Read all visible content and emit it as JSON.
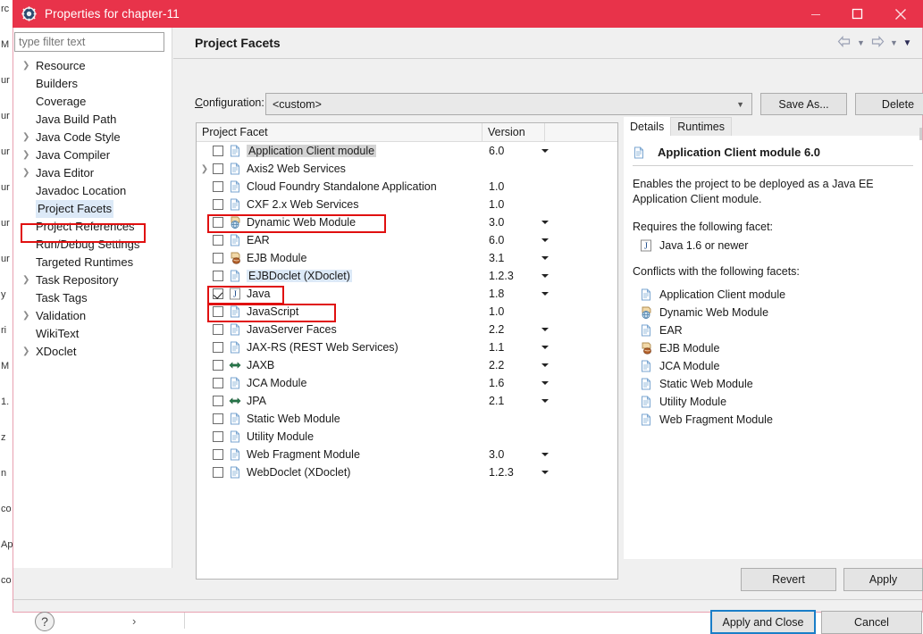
{
  "window": {
    "title": "Properties for chapter-11",
    "icon": "gear-icon",
    "accent_color": "#e8334a",
    "controls": {
      "minimize": "—",
      "maximize": "☐",
      "close": "✕"
    }
  },
  "sidebar": {
    "filter_placeholder": "type filter text",
    "filter_value": "",
    "items": [
      {
        "label": "Resource",
        "expandable": true,
        "selected": false
      },
      {
        "label": "Builders",
        "expandable": false,
        "selected": false
      },
      {
        "label": "Coverage",
        "expandable": false,
        "selected": false
      },
      {
        "label": "Java Build Path",
        "expandable": false,
        "selected": false
      },
      {
        "label": "Java Code Style",
        "expandable": true,
        "selected": false
      },
      {
        "label": "Java Compiler",
        "expandable": true,
        "selected": false
      },
      {
        "label": "Java Editor",
        "expandable": true,
        "selected": false
      },
      {
        "label": "Javadoc Location",
        "expandable": false,
        "selected": false
      },
      {
        "label": "Project Facets",
        "expandable": false,
        "selected": true
      },
      {
        "label": "Project References",
        "expandable": false,
        "selected": false
      },
      {
        "label": "Run/Debug Settings",
        "expandable": false,
        "selected": false
      },
      {
        "label": "Targeted Runtimes",
        "expandable": false,
        "selected": false
      },
      {
        "label": "Task Repository",
        "expandable": true,
        "selected": false
      },
      {
        "label": "Task Tags",
        "expandable": false,
        "selected": false
      },
      {
        "label": "Validation",
        "expandable": true,
        "selected": false
      },
      {
        "label": "WikiText",
        "expandable": false,
        "selected": false
      },
      {
        "label": "XDoclet",
        "expandable": true,
        "selected": false
      }
    ]
  },
  "page": {
    "title": "Project Facets",
    "nav": {
      "back_icon": "back-arrow-icon",
      "forward_icon": "forward-arrow-icon",
      "menu_icon": "chevron-down-icon"
    }
  },
  "configuration": {
    "label": "Configuration:",
    "value": "<custom>",
    "save_as_label": "Save As...",
    "delete_label": "Delete"
  },
  "facet_table": {
    "columns": [
      "Project Facet",
      "Version",
      ""
    ],
    "rows": [
      {
        "name": "Application Client module",
        "version": "6.0",
        "checked": false,
        "expandable": false,
        "has_version_dropdown": true,
        "icon": "file-icon",
        "state": "selected"
      },
      {
        "name": "Axis2 Web Services",
        "version": "",
        "checked": false,
        "expandable": true,
        "has_version_dropdown": false,
        "icon": "file-icon",
        "state": ""
      },
      {
        "name": "Cloud Foundry Standalone Application",
        "version": "1.0",
        "checked": false,
        "expandable": false,
        "has_version_dropdown": false,
        "icon": "file-icon",
        "state": ""
      },
      {
        "name": "CXF 2.x Web Services",
        "version": "1.0",
        "checked": false,
        "expandable": false,
        "has_version_dropdown": false,
        "icon": "file-icon",
        "state": ""
      },
      {
        "name": "Dynamic Web Module",
        "version": "3.0",
        "checked": false,
        "expandable": false,
        "has_version_dropdown": true,
        "icon": "web-module-icon",
        "state": ""
      },
      {
        "name": "EAR",
        "version": "6.0",
        "checked": false,
        "expandable": false,
        "has_version_dropdown": true,
        "icon": "file-icon",
        "state": ""
      },
      {
        "name": "EJB Module",
        "version": "3.1",
        "checked": false,
        "expandable": false,
        "has_version_dropdown": true,
        "icon": "ejb-icon",
        "state": ""
      },
      {
        "name": "EJBDoclet (XDoclet)",
        "version": "1.2.3",
        "checked": false,
        "expandable": false,
        "has_version_dropdown": true,
        "icon": "file-icon",
        "state": "hover"
      },
      {
        "name": "Java",
        "version": "1.8",
        "checked": true,
        "expandable": false,
        "has_version_dropdown": true,
        "icon": "java-icon",
        "state": ""
      },
      {
        "name": "JavaScript",
        "version": "1.0",
        "checked": false,
        "expandable": false,
        "has_version_dropdown": false,
        "icon": "file-icon",
        "state": ""
      },
      {
        "name": "JavaServer Faces",
        "version": "2.2",
        "checked": false,
        "expandable": false,
        "has_version_dropdown": true,
        "icon": "file-icon",
        "state": ""
      },
      {
        "name": "JAX-RS (REST Web Services)",
        "version": "1.1",
        "checked": false,
        "expandable": false,
        "has_version_dropdown": true,
        "icon": "file-icon",
        "state": ""
      },
      {
        "name": "JAXB",
        "version": "2.2",
        "checked": false,
        "expandable": false,
        "has_version_dropdown": true,
        "icon": "jaxb-icon",
        "state": ""
      },
      {
        "name": "JCA Module",
        "version": "1.6",
        "checked": false,
        "expandable": false,
        "has_version_dropdown": true,
        "icon": "file-icon",
        "state": ""
      },
      {
        "name": "JPA",
        "version": "2.1",
        "checked": false,
        "expandable": false,
        "has_version_dropdown": true,
        "icon": "jaxb-icon",
        "state": ""
      },
      {
        "name": "Static Web Module",
        "version": "",
        "checked": false,
        "expandable": false,
        "has_version_dropdown": false,
        "icon": "file-icon",
        "state": ""
      },
      {
        "name": "Utility Module",
        "version": "",
        "checked": false,
        "expandable": false,
        "has_version_dropdown": false,
        "icon": "file-icon",
        "state": ""
      },
      {
        "name": "Web Fragment Module",
        "version": "3.0",
        "checked": false,
        "expandable": false,
        "has_version_dropdown": true,
        "icon": "file-icon",
        "state": ""
      },
      {
        "name": "WebDoclet (XDoclet)",
        "version": "1.2.3",
        "checked": false,
        "expandable": false,
        "has_version_dropdown": true,
        "icon": "file-icon",
        "state": ""
      }
    ]
  },
  "annotations": {
    "highlight_color": "#e01010",
    "boxes": [
      "Project Facets",
      "Dynamic Web Module",
      "Java",
      "JavaScript"
    ]
  },
  "details": {
    "tabs": [
      {
        "label": "Details",
        "active": true
      },
      {
        "label": "Runtimes",
        "active": false
      }
    ],
    "title": "Application Client module 6.0",
    "description": "Enables the project to be deployed as a Java EE Application Client module.",
    "requires_label": "Requires the following facet:",
    "requires": [
      {
        "name": "Java 1.6 or newer",
        "icon": "java-icon"
      }
    ],
    "conflicts_label": "Conflicts with the following facets:",
    "conflicts": [
      {
        "name": "Application Client module",
        "icon": "file-icon"
      },
      {
        "name": "Dynamic Web Module",
        "icon": "web-module-icon"
      },
      {
        "name": "EAR",
        "icon": "file-icon"
      },
      {
        "name": "EJB Module",
        "icon": "ejb-icon"
      },
      {
        "name": "JCA Module",
        "icon": "file-icon"
      },
      {
        "name": "Static Web Module",
        "icon": "file-icon"
      },
      {
        "name": "Utility Module",
        "icon": "file-icon"
      },
      {
        "name": "Web Fragment Module",
        "icon": "file-icon"
      }
    ]
  },
  "actions": {
    "revert": "Revert",
    "apply": "Apply",
    "apply_and_close": "Apply and Close",
    "cancel": "Cancel",
    "help_icon": "help-icon"
  },
  "background_app": {
    "left_edge_text": [
      "rc",
      "M",
      "ur",
      "ur",
      "ur",
      "ur",
      "ur",
      "ur",
      "y",
      "ri",
      "M",
      "1.",
      "z",
      "n",
      "co",
      "Ap",
      "co"
    ],
    "chevron": "›"
  }
}
